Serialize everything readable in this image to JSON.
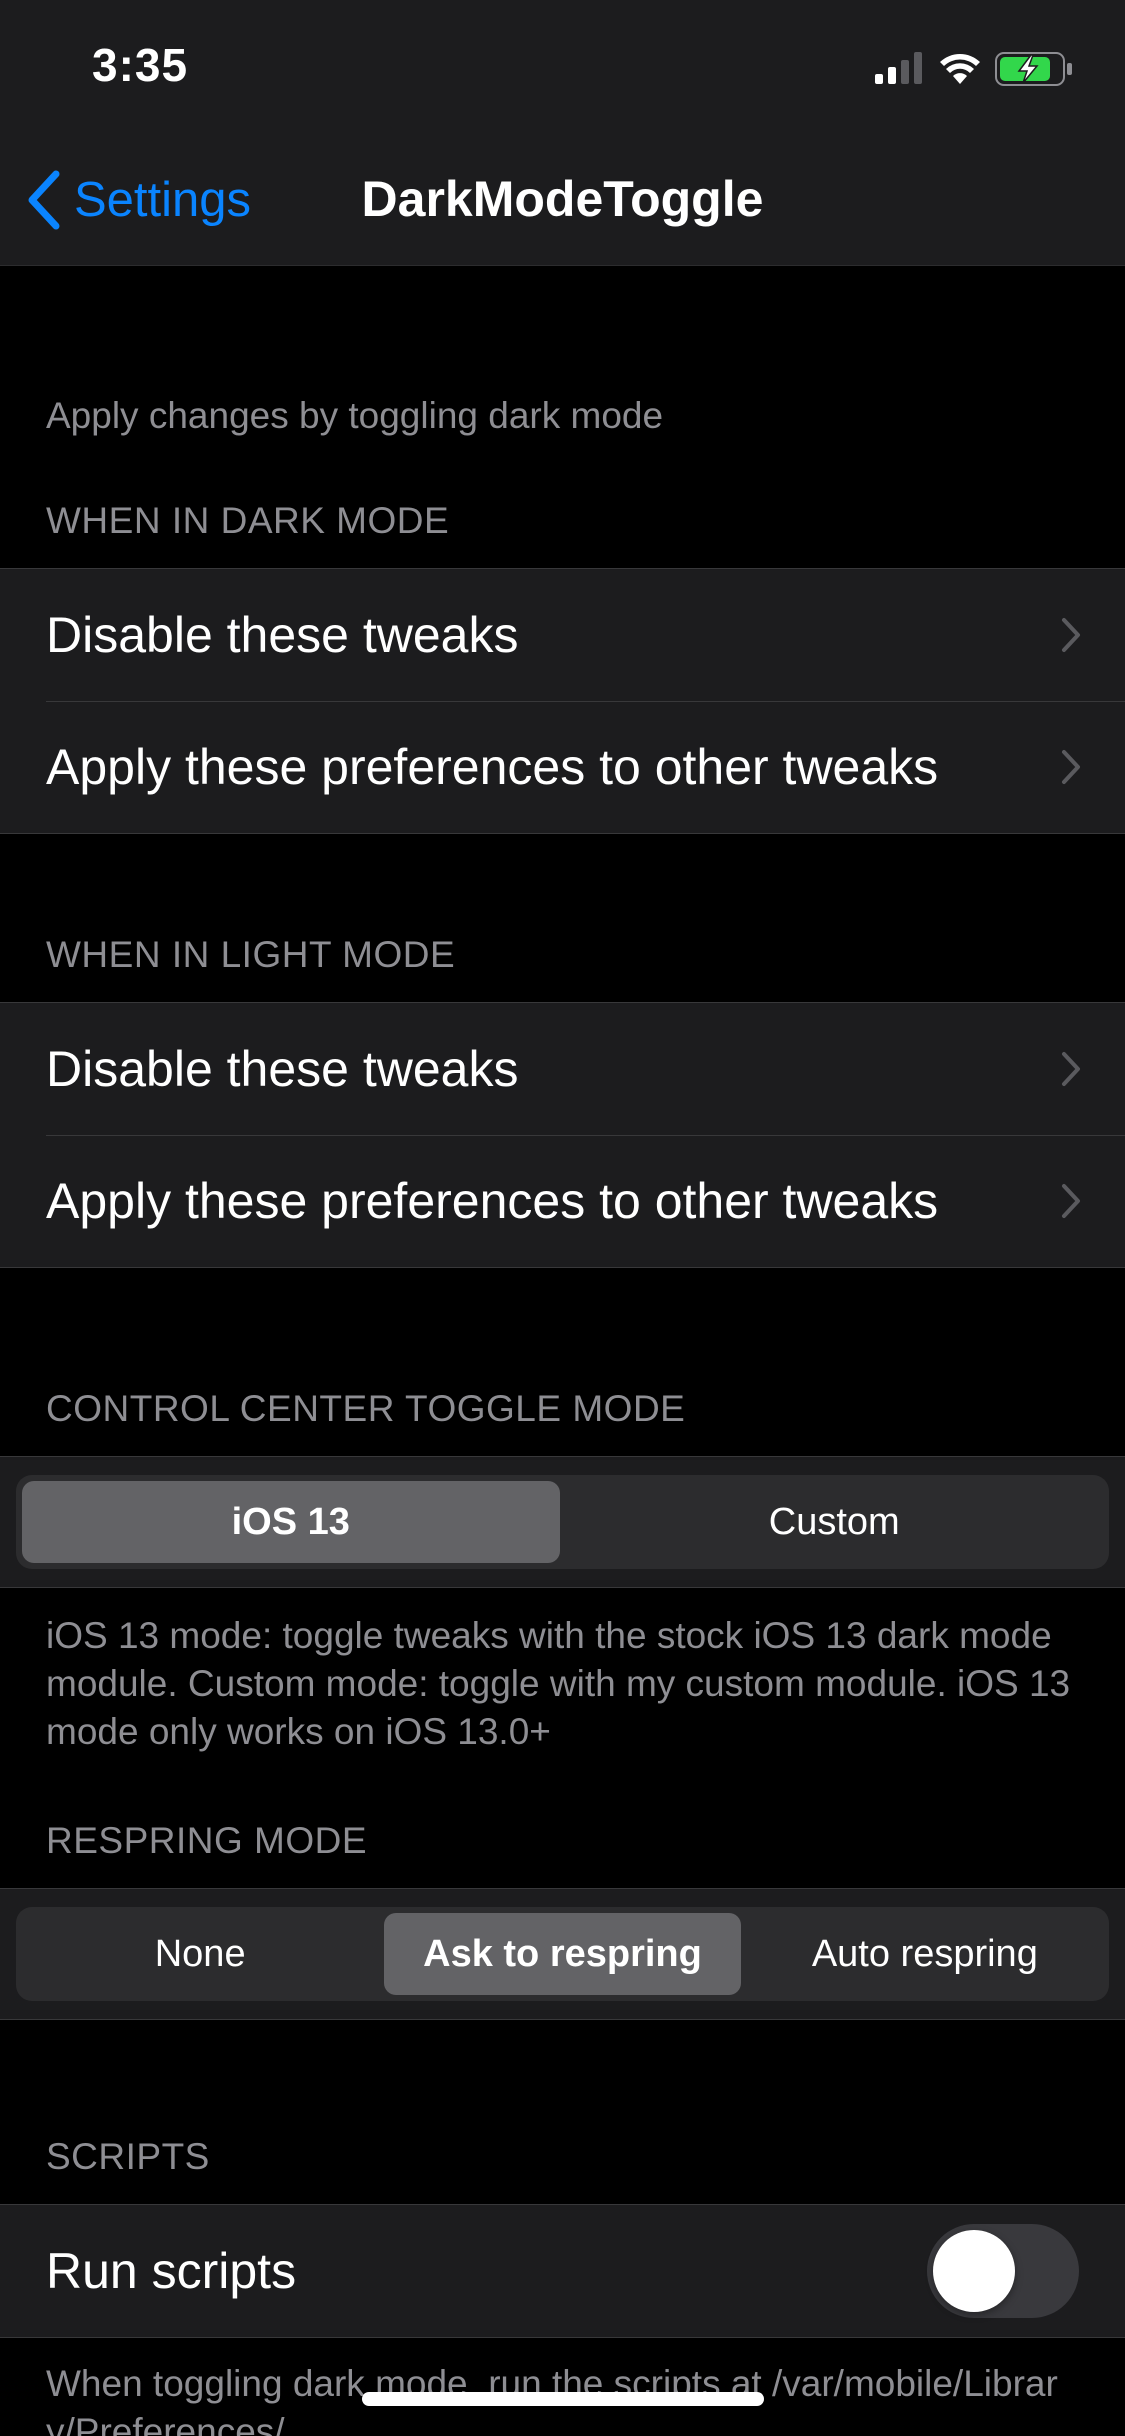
{
  "status_bar": {
    "time": "3:35",
    "icons": [
      "cellular-signal-icon",
      "wifi-icon",
      "battery-charging-icon"
    ],
    "battery_color": "#32d74b"
  },
  "nav": {
    "back_label": "Settings",
    "title": "DarkModeToggle",
    "accent_color": "#0a84ff"
  },
  "intro_text": "Apply changes by toggling dark mode",
  "dark_mode_section": {
    "header": "WHEN IN DARK MODE",
    "items": [
      {
        "label": "Disable these tweaks"
      },
      {
        "label": "Apply these preferences to other tweaks"
      }
    ]
  },
  "light_mode_section": {
    "header": "WHEN IN LIGHT MODE",
    "items": [
      {
        "label": "Disable these tweaks"
      },
      {
        "label": "Apply these preferences to other tweaks"
      }
    ]
  },
  "cc_toggle_section": {
    "header": "CONTROL CENTER TOGGLE MODE",
    "options": [
      "iOS 13",
      "Custom"
    ],
    "selected": "iOS 13",
    "footer": "iOS 13 mode: toggle tweaks with the stock iOS 13 dark mode module. Custom mode: toggle with my custom module. iOS 13 mode only works on iOS 13.0+"
  },
  "respring_section": {
    "header": "RESPRING MODE",
    "options": [
      "None",
      "Ask to respring",
      "Auto respring"
    ],
    "selected": "Ask to respring"
  },
  "scripts_section": {
    "header": "SCRIPTS",
    "run_scripts_label": "Run scripts",
    "run_scripts_enabled": false,
    "footer": "When toggling dark mode, run the scripts at /var/mobile/Library/Preferences/"
  }
}
